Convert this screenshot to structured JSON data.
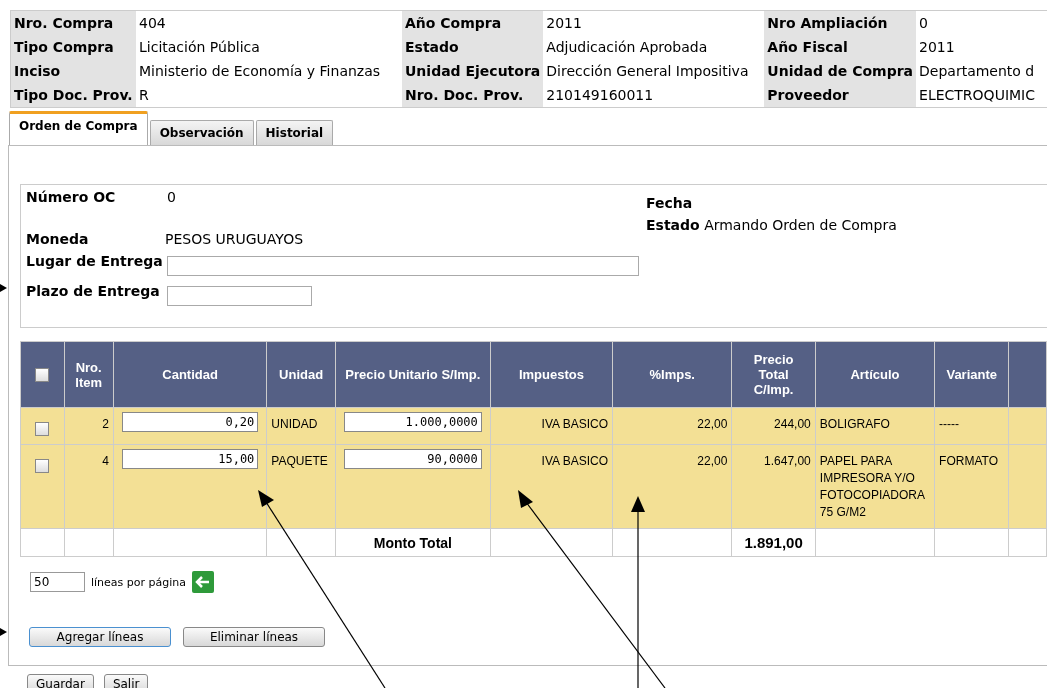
{
  "header": [
    [
      {
        "label": "Nro. Compra",
        "value": "404"
      },
      {
        "label": "Año Compra",
        "value": "2011"
      },
      {
        "label": "Nro Ampliación",
        "value": "0"
      }
    ],
    [
      {
        "label": "Tipo Compra",
        "value": "Licitación Pública"
      },
      {
        "label": "Estado",
        "value": "Adjudicación Aprobada"
      },
      {
        "label": "Año Fiscal",
        "value": "2011"
      }
    ],
    [
      {
        "label": "Inciso",
        "value": "Ministerio de Economía y Finanzas"
      },
      {
        "label": "Unidad Ejecutora",
        "value": "Dirección General Impositiva"
      },
      {
        "label": "Unidad de Compra",
        "value": "Departamento d"
      }
    ],
    [
      {
        "label": "Tipo Doc. Prov.",
        "value": "R"
      },
      {
        "label": "Nro. Doc. Prov.",
        "value": "210149160011"
      },
      {
        "label": "Proveedor",
        "value": "ELECTROQUIMIC"
      }
    ]
  ],
  "tabs": [
    {
      "label": "Orden de Compra",
      "selected": true
    },
    {
      "label": "Observación",
      "selected": false
    },
    {
      "label": "Historial",
      "selected": false
    }
  ],
  "order": {
    "numero_label": "Número OC",
    "numero": "0",
    "fecha_label": "Fecha",
    "estado_label": "Estado",
    "estado": "Armando Orden de Compra",
    "moneda_label": "Moneda",
    "moneda": "PESOS URUGUAYOS",
    "lugar_label": "Lugar de Entrega",
    "plazo_label": "Plazo de Entrega"
  },
  "table": {
    "columns": [
      "Nro. Item",
      "Cantidad",
      "Unidad",
      "Precio Unitario S/Imp.",
      "Impuestos",
      "%Imps.",
      "Precio Total C/Imp.",
      "Artículo",
      "Variante"
    ],
    "all_checked": false,
    "rows": [
      {
        "checked": false,
        "item": "2",
        "cantidad": "0,20",
        "unidad": "UNIDAD",
        "precio": "1.000,0000",
        "impuestos": "IVA BASICO",
        "pct": "22,00",
        "total": "244,00",
        "articulo": "BOLIGRAFO",
        "variante": "-----"
      },
      {
        "checked": false,
        "item": "4",
        "cantidad": "15,00",
        "unidad": "PAQUETE",
        "precio": "90,0000",
        "impuestos": "IVA BASICO",
        "pct": "22,00",
        "total": "1.647,00",
        "articulo": "PAPEL PARA IMPRESORA Y/O FOTOCOPIADORA 75 G/M2",
        "variante": "FORMATO"
      }
    ],
    "total_label": "Monto Total",
    "total_value": "1.891,00"
  },
  "paging": {
    "value": "50",
    "label": "líneas por página"
  },
  "line_buttons": [
    "Agregar líneas",
    "Eliminar líneas"
  ],
  "buttons": [
    "Guardar",
    "Salir"
  ]
}
